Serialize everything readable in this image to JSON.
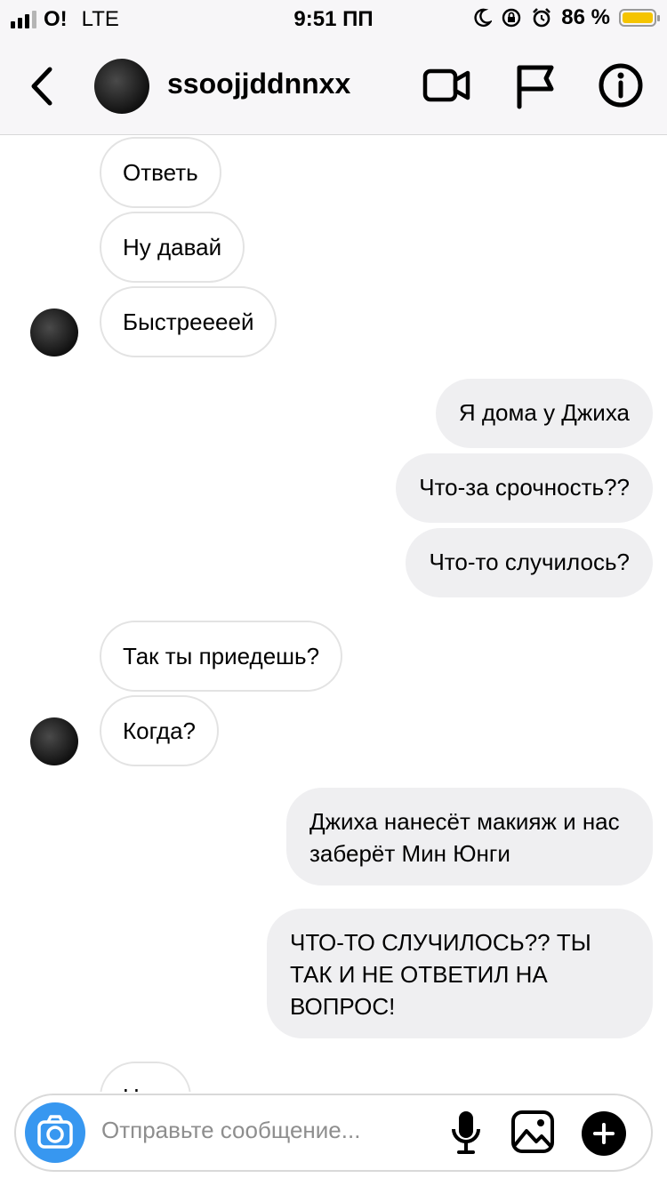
{
  "status_bar": {
    "carrier": "O!",
    "network": "LTE",
    "time": "9:51 ПП",
    "battery": "86 %",
    "battery_level": 0.86
  },
  "header": {
    "username": "ssoojjddnnxx",
    "icons": [
      "back-icon",
      "video-call-icon",
      "flag-icon",
      "info-icon"
    ]
  },
  "messages": [
    {
      "side": "in",
      "text": "Ответь"
    },
    {
      "side": "in",
      "text": "Ну давай"
    },
    {
      "side": "in",
      "text": "Быстреееей"
    },
    {
      "side": "out",
      "text": "Я дома у Джиха"
    },
    {
      "side": "out",
      "text": "Что-за срочность??"
    },
    {
      "side": "out",
      "text": "Что-то случилось?"
    },
    {
      "side": "in",
      "text": "Так ты приедешь?"
    },
    {
      "side": "in",
      "text": "Когда?"
    },
    {
      "side": "out",
      "text": "Джиха нанесёт макияж и нас заберёт Мин Юнги"
    },
    {
      "side": "out",
      "text": "ЧТО-ТО СЛУЧИЛОСЬ?? ТЫ ТАК И НЕ ОТВЕТИЛ НА ВОПРОС!"
    },
    {
      "side": "in",
      "text": "Ну..."
    }
  ],
  "composer": {
    "placeholder": "Отправьте сообщение...",
    "icons": [
      "camera-icon",
      "microphone-icon",
      "gallery-icon",
      "plus-icon"
    ]
  },
  "colors": {
    "accent": "#3797f0",
    "outgoing_bubble": "#efeff1",
    "battery": "#f5c400"
  }
}
